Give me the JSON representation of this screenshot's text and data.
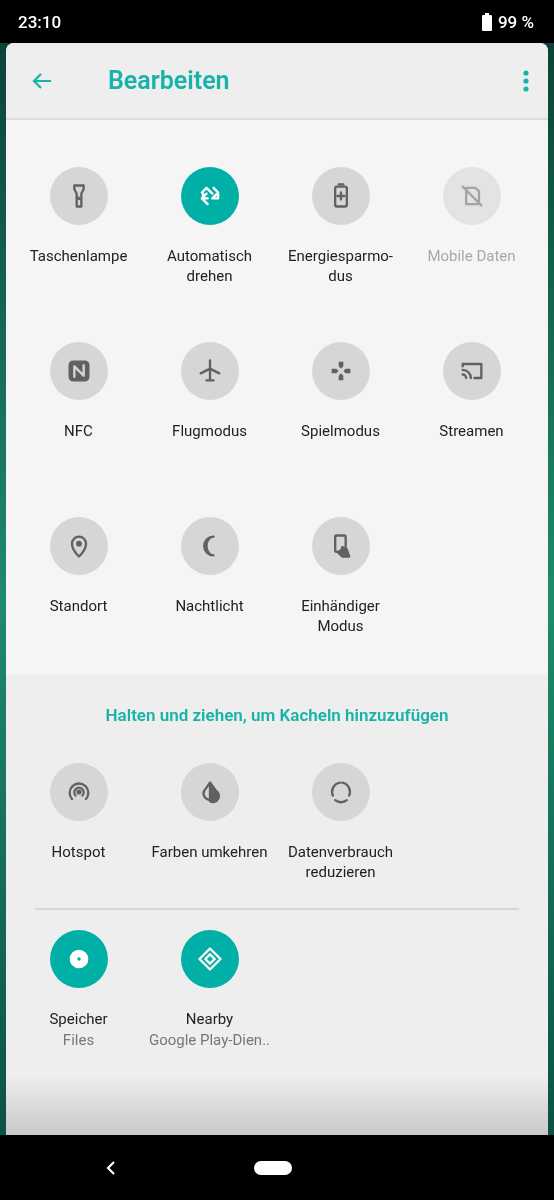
{
  "status_bar": {
    "time": "23:10",
    "battery": "99 %"
  },
  "header": {
    "title": "Bearbeiten"
  },
  "tiles": [
    {
      "label": "Taschenlampe",
      "on": false,
      "disabled": false
    },
    {
      "label": "Automatisch drehen",
      "on": true,
      "disabled": false
    },
    {
      "label": "Energiesparmo-dus",
      "on": false,
      "disabled": false
    },
    {
      "label": "Mobile Daten",
      "on": false,
      "disabled": true
    },
    {
      "label": "NFC",
      "on": false,
      "disabled": false
    },
    {
      "label": "Flugmodus",
      "on": false,
      "disabled": false
    },
    {
      "label": "Spielmodus",
      "on": false,
      "disabled": false
    },
    {
      "label": "Streamen",
      "on": false,
      "disabled": false
    },
    {
      "label": "Standort",
      "on": false,
      "disabled": false
    },
    {
      "label": "Nachtlicht",
      "on": false,
      "disabled": false
    },
    {
      "label": "Einhändiger Modus",
      "on": false,
      "disabled": false
    }
  ],
  "available": {
    "hint": "Halten und ziehen, um Kacheln hinzuzufügen",
    "tiles": [
      {
        "label": "Hotspot",
        "on": false,
        "disabled": false
      },
      {
        "label": "Farben umkehren",
        "on": false,
        "disabled": false
      },
      {
        "label": "Datenverbrauch reduzieren",
        "on": false,
        "disabled": false
      }
    ],
    "app_tiles": [
      {
        "label": "Speicher",
        "subtitle": "Files",
        "on": true,
        "disabled": false
      },
      {
        "label": "Nearby",
        "subtitle": "Google Play-Dien..",
        "on": true,
        "disabled": false
      }
    ]
  }
}
